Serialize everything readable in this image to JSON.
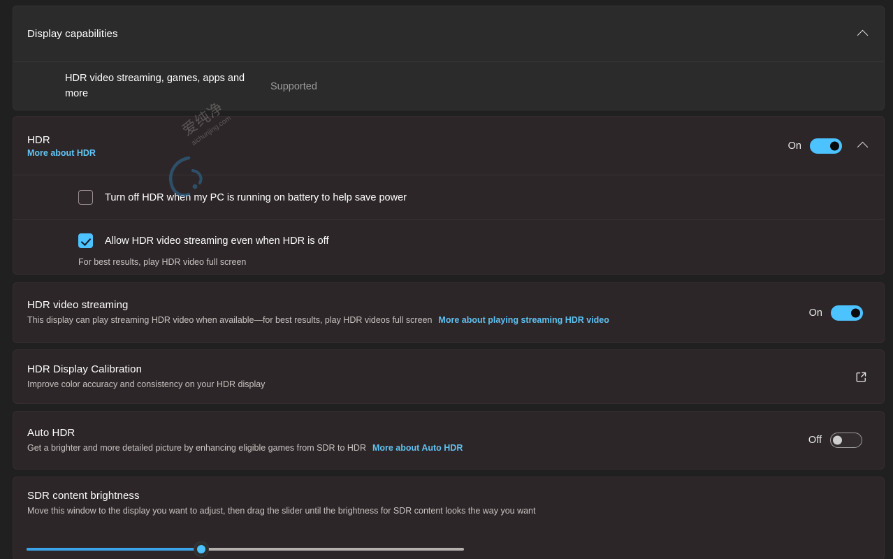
{
  "page": {
    "background": "#202020",
    "card_background": "#2b2b2b",
    "card_background_tinted": "#2d2629",
    "accent": "#4cc2ff",
    "link_color": "#5ec2f0"
  },
  "display_capabilities": {
    "header": "Display capabilities",
    "collapse_icon": "chevron-up-icon",
    "rows": [
      {
        "label": "HDR video streaming, games, apps and more",
        "value": "Supported"
      }
    ]
  },
  "hdr": {
    "title": "HDR",
    "link": "More about HDR",
    "state_label": "On",
    "toggle_state": "on",
    "collapse_icon": "chevron-up-icon",
    "options": [
      {
        "label": "Turn off HDR when my PC is running on battery to help save power",
        "checked": false,
        "description": ""
      },
      {
        "label": "Allow HDR video streaming even when HDR is off",
        "checked": true,
        "description": "For best results, play HDR video full screen"
      }
    ]
  },
  "hdr_video_streaming": {
    "title": "HDR video streaming",
    "description": "This display can play streaming HDR video when available—for best results, play HDR videos full screen",
    "link": "More about playing streaming HDR video",
    "state_label": "On",
    "toggle_state": "on"
  },
  "hdr_display_calibration": {
    "title": "HDR Display Calibration",
    "description": "Improve color accuracy and consistency on your HDR display",
    "action_icon": "external-link-icon"
  },
  "auto_hdr": {
    "title": "Auto HDR",
    "description": "Get a brighter and more detailed picture by enhancing eligible games from SDR to HDR",
    "link": "More about Auto HDR",
    "state_label": "Off",
    "toggle_state": "off"
  },
  "sdr_content_brightness": {
    "title": "SDR content brightness",
    "description": "Move this window to the display you want to adjust, then drag the slider until the brightness for SDR content looks the way you want",
    "slider": {
      "min": 0,
      "max": 100,
      "value": 40,
      "fill_color": "#3aa3ea",
      "track_color": "#b4b0ae"
    }
  },
  "watermark": {
    "text": "爱纯净",
    "domain": "aichunjing.com"
  }
}
